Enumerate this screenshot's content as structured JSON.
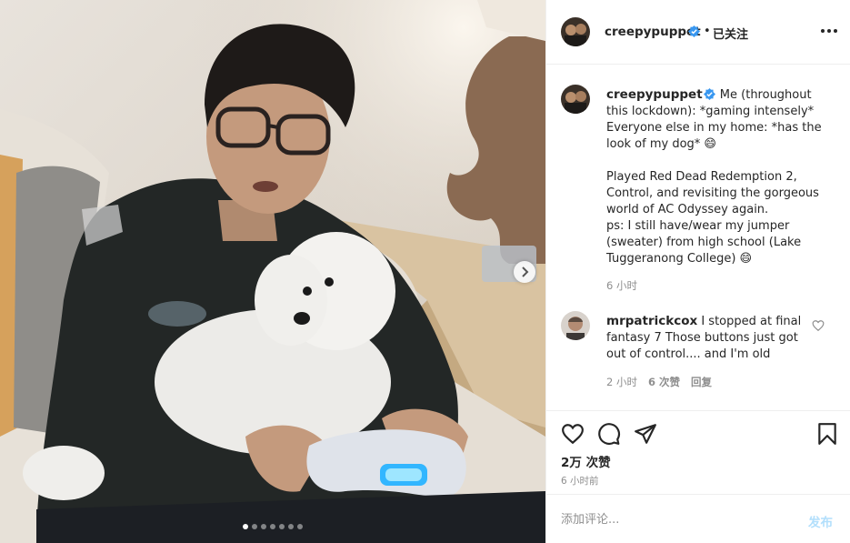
{
  "post": {
    "username": "creepypuppet",
    "follow_status": "已关注",
    "separator": "•",
    "images_total": 7,
    "image_index": 1
  },
  "caption": {
    "username": "creepypuppet",
    "text": "Me (throughout this lockdown): *gaming intensely*\nEveryone else in my home: *has the look of my dog* 😄\n\nPlayed Red Dead Redemption 2, Control, and revisiting the gorgeous world of AC Odyssey again.\nps: I still have/wear my jumper (sweater) from high school (Lake Tuggeranong College) 😄",
    "time": "6 小时"
  },
  "comment": {
    "username": "mrpatrickcox",
    "text": "I stopped at final fantasy 7 Those buttons just got out of control.... and I'm old",
    "time": "2 小时",
    "likes": "6 次赞",
    "reply": "回复"
  },
  "actions": {
    "likes_count": "2万 次赞",
    "post_time": "6 小时前"
  },
  "add_comment": {
    "placeholder": "添加评论...",
    "post_label": "发布"
  },
  "colors": {
    "verified": "#3897f0",
    "post_button_disabled": "#b2dffc",
    "secondary_text": "#8e8e8e"
  },
  "icons": [
    "verified-badge-icon",
    "more-options-icon",
    "heart-icon",
    "comment-icon",
    "share-icon",
    "bookmark-icon",
    "chevron-right-icon"
  ]
}
